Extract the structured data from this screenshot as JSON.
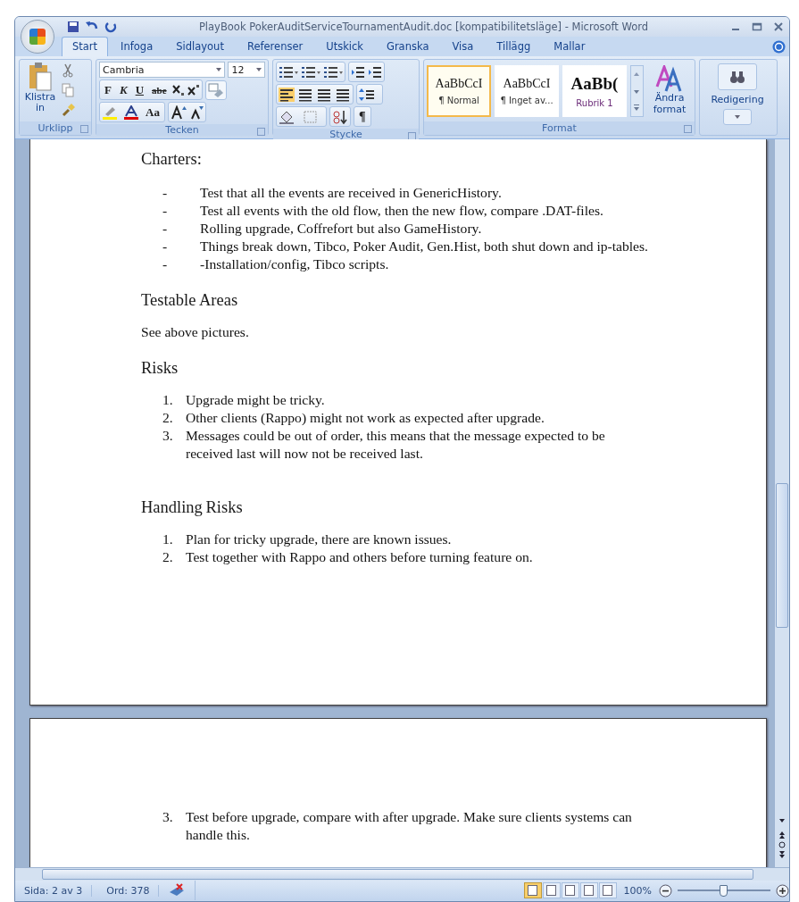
{
  "window": {
    "title": "PlayBook PokerAuditServiceTournamentAudit.doc [kompatibilitetsläge] - Microsoft Word"
  },
  "tabs": [
    {
      "label": "Start",
      "selected": true
    },
    {
      "label": "Infoga",
      "selected": false
    },
    {
      "label": "Sidlayout",
      "selected": false
    },
    {
      "label": "Referenser",
      "selected": false
    },
    {
      "label": "Utskick",
      "selected": false
    },
    {
      "label": "Granska",
      "selected": false
    },
    {
      "label": "Visa",
      "selected": false
    },
    {
      "label": "Tillägg",
      "selected": false
    },
    {
      "label": "Mallar",
      "selected": false
    }
  ],
  "ribbon": {
    "clipboard": {
      "paste": "Klistra in",
      "label": "Urklipp"
    },
    "font": {
      "name": "Cambria",
      "size": "12",
      "label": "Tecken",
      "buttons": [
        "F",
        "K",
        "U",
        "abe",
        "Aa"
      ]
    },
    "paragraph": {
      "label": "Stycke",
      "mark": "¶"
    },
    "styles": {
      "label": "Format",
      "items": [
        {
          "preview": "AaBbCcI",
          "name": "¶ Normal",
          "selected": true,
          "kind": "normal"
        },
        {
          "preview": "AaBbCcI",
          "name": "¶ Inget av...",
          "selected": false,
          "kind": "normal"
        },
        {
          "preview": "AaBb(",
          "name": "Rubrik 1",
          "selected": false,
          "kind": "heading"
        }
      ],
      "change": "Ändra format"
    },
    "editing": {
      "label": "Redigering"
    }
  },
  "pages": [
    {
      "blocks": [
        {
          "kind": "heading",
          "text": "Charters:"
        },
        {
          "kind": "bullets",
          "items": [
            {
              "marker": "-",
              "text": "Test that all the events are received in GenericHistory."
            },
            {
              "marker": "-",
              "text": "Test all events with the old flow, then the new flow, compare .DAT-files."
            },
            {
              "marker": "-",
              "text": "Rolling upgrade, Coffrefort but also GameHistory."
            },
            {
              "marker": "-",
              "text": "Things break down, Tibco, Poker Audit, Gen.Hist, both shut down and ip-tables."
            },
            {
              "marker": "-",
              "text": "-Installation/config, Tibco scripts."
            }
          ]
        },
        {
          "kind": "heading",
          "text": "Testable Areas"
        },
        {
          "kind": "para",
          "text": "See above pictures."
        },
        {
          "kind": "heading",
          "text": "Risks"
        },
        {
          "kind": "numbered",
          "items": [
            {
              "marker": "1.",
              "text": "Upgrade might be tricky."
            },
            {
              "marker": "2.",
              "text": "Other clients (Rappo) might not work as expected after upgrade."
            },
            {
              "marker": "3.",
              "text": "Messages could be out of order, this means that the message expected to be received last will now not be received last."
            }
          ]
        },
        {
          "kind": "heading",
          "text": "Handling Risks",
          "space": true
        },
        {
          "kind": "numbered",
          "items": [
            {
              "marker": "1.",
              "text": "Plan for tricky upgrade, there are known issues."
            },
            {
              "marker": "2.",
              "text": "Test together with Rappo and others before turning feature on."
            }
          ]
        }
      ]
    },
    {
      "blocks": [
        {
          "kind": "numbered",
          "items": [
            {
              "marker": "3.",
              "text": "Test before upgrade, compare with after upgrade. Make sure clients systems can handle this."
            }
          ]
        }
      ]
    }
  ],
  "status_bar": {
    "page": "Sida: 2 av 3",
    "words": "Ord: 378",
    "views": [
      {
        "selected": true
      },
      {
        "selected": false
      },
      {
        "selected": false
      },
      {
        "selected": false
      },
      {
        "selected": false
      }
    ],
    "zoom": "100%",
    "zoom_slider": {
      "level": 0.5
    }
  }
}
